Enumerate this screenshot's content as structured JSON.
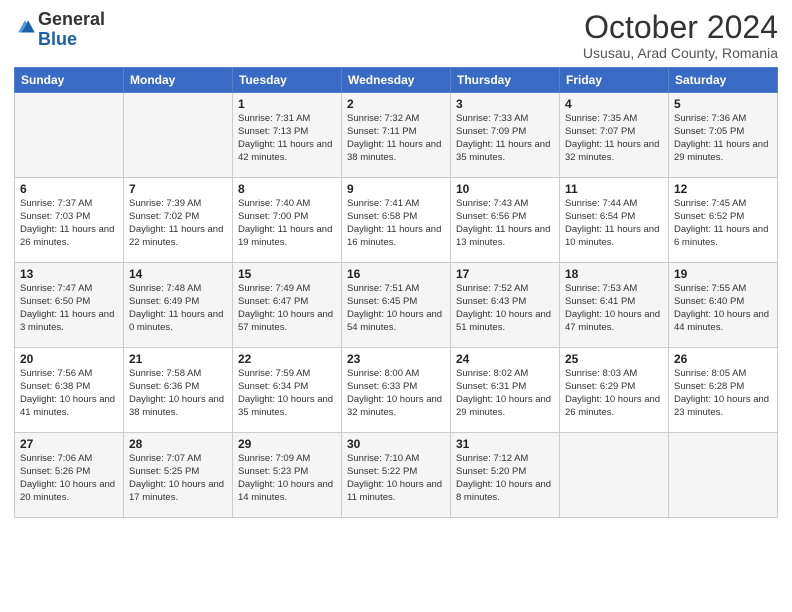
{
  "header": {
    "logo_general": "General",
    "logo_blue": "Blue",
    "month_title": "October 2024",
    "location": "Ususau, Arad County, Romania"
  },
  "weekdays": [
    "Sunday",
    "Monday",
    "Tuesday",
    "Wednesday",
    "Thursday",
    "Friday",
    "Saturday"
  ],
  "weeks": [
    [
      {
        "day": "",
        "info": ""
      },
      {
        "day": "",
        "info": ""
      },
      {
        "day": "1",
        "info": "Sunrise: 7:31 AM\nSunset: 7:13 PM\nDaylight: 11 hours and 42 minutes."
      },
      {
        "day": "2",
        "info": "Sunrise: 7:32 AM\nSunset: 7:11 PM\nDaylight: 11 hours and 38 minutes."
      },
      {
        "day": "3",
        "info": "Sunrise: 7:33 AM\nSunset: 7:09 PM\nDaylight: 11 hours and 35 minutes."
      },
      {
        "day": "4",
        "info": "Sunrise: 7:35 AM\nSunset: 7:07 PM\nDaylight: 11 hours and 32 minutes."
      },
      {
        "day": "5",
        "info": "Sunrise: 7:36 AM\nSunset: 7:05 PM\nDaylight: 11 hours and 29 minutes."
      }
    ],
    [
      {
        "day": "6",
        "info": "Sunrise: 7:37 AM\nSunset: 7:03 PM\nDaylight: 11 hours and 26 minutes."
      },
      {
        "day": "7",
        "info": "Sunrise: 7:39 AM\nSunset: 7:02 PM\nDaylight: 11 hours and 22 minutes."
      },
      {
        "day": "8",
        "info": "Sunrise: 7:40 AM\nSunset: 7:00 PM\nDaylight: 11 hours and 19 minutes."
      },
      {
        "day": "9",
        "info": "Sunrise: 7:41 AM\nSunset: 6:58 PM\nDaylight: 11 hours and 16 minutes."
      },
      {
        "day": "10",
        "info": "Sunrise: 7:43 AM\nSunset: 6:56 PM\nDaylight: 11 hours and 13 minutes."
      },
      {
        "day": "11",
        "info": "Sunrise: 7:44 AM\nSunset: 6:54 PM\nDaylight: 11 hours and 10 minutes."
      },
      {
        "day": "12",
        "info": "Sunrise: 7:45 AM\nSunset: 6:52 PM\nDaylight: 11 hours and 6 minutes."
      }
    ],
    [
      {
        "day": "13",
        "info": "Sunrise: 7:47 AM\nSunset: 6:50 PM\nDaylight: 11 hours and 3 minutes."
      },
      {
        "day": "14",
        "info": "Sunrise: 7:48 AM\nSunset: 6:49 PM\nDaylight: 11 hours and 0 minutes."
      },
      {
        "day": "15",
        "info": "Sunrise: 7:49 AM\nSunset: 6:47 PM\nDaylight: 10 hours and 57 minutes."
      },
      {
        "day": "16",
        "info": "Sunrise: 7:51 AM\nSunset: 6:45 PM\nDaylight: 10 hours and 54 minutes."
      },
      {
        "day": "17",
        "info": "Sunrise: 7:52 AM\nSunset: 6:43 PM\nDaylight: 10 hours and 51 minutes."
      },
      {
        "day": "18",
        "info": "Sunrise: 7:53 AM\nSunset: 6:41 PM\nDaylight: 10 hours and 47 minutes."
      },
      {
        "day": "19",
        "info": "Sunrise: 7:55 AM\nSunset: 6:40 PM\nDaylight: 10 hours and 44 minutes."
      }
    ],
    [
      {
        "day": "20",
        "info": "Sunrise: 7:56 AM\nSunset: 6:38 PM\nDaylight: 10 hours and 41 minutes."
      },
      {
        "day": "21",
        "info": "Sunrise: 7:58 AM\nSunset: 6:36 PM\nDaylight: 10 hours and 38 minutes."
      },
      {
        "day": "22",
        "info": "Sunrise: 7:59 AM\nSunset: 6:34 PM\nDaylight: 10 hours and 35 minutes."
      },
      {
        "day": "23",
        "info": "Sunrise: 8:00 AM\nSunset: 6:33 PM\nDaylight: 10 hours and 32 minutes."
      },
      {
        "day": "24",
        "info": "Sunrise: 8:02 AM\nSunset: 6:31 PM\nDaylight: 10 hours and 29 minutes."
      },
      {
        "day": "25",
        "info": "Sunrise: 8:03 AM\nSunset: 6:29 PM\nDaylight: 10 hours and 26 minutes."
      },
      {
        "day": "26",
        "info": "Sunrise: 8:05 AM\nSunset: 6:28 PM\nDaylight: 10 hours and 23 minutes."
      }
    ],
    [
      {
        "day": "27",
        "info": "Sunrise: 7:06 AM\nSunset: 5:26 PM\nDaylight: 10 hours and 20 minutes."
      },
      {
        "day": "28",
        "info": "Sunrise: 7:07 AM\nSunset: 5:25 PM\nDaylight: 10 hours and 17 minutes."
      },
      {
        "day": "29",
        "info": "Sunrise: 7:09 AM\nSunset: 5:23 PM\nDaylight: 10 hours and 14 minutes."
      },
      {
        "day": "30",
        "info": "Sunrise: 7:10 AM\nSunset: 5:22 PM\nDaylight: 10 hours and 11 minutes."
      },
      {
        "day": "31",
        "info": "Sunrise: 7:12 AM\nSunset: 5:20 PM\nDaylight: 10 hours and 8 minutes."
      },
      {
        "day": "",
        "info": ""
      },
      {
        "day": "",
        "info": ""
      }
    ]
  ]
}
